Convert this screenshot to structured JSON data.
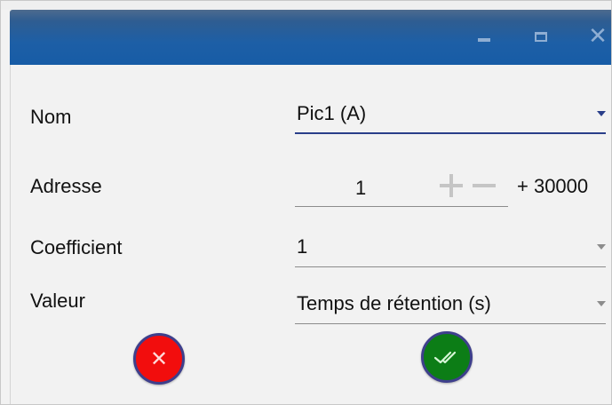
{
  "window": {
    "minimize_icon": "minimize-icon",
    "maximize_icon": "maximize-icon",
    "close_icon": "close-icon",
    "close_glyph": "✕"
  },
  "form": {
    "nom": {
      "label": "Nom",
      "value": "Pic1 (A)"
    },
    "adresse": {
      "label": "Adresse",
      "value": "1",
      "offset": "+ 30000"
    },
    "coefficient": {
      "label": "Coefficient",
      "value": "1"
    },
    "valeur": {
      "label": "Valeur",
      "value": "Temps de rétention (s)"
    }
  },
  "actions": {
    "cancel_glyph": "✕",
    "cancel_color": "#f20d0d",
    "ok_color": "#0c7d16",
    "ok_icon": "double-check-icon"
  },
  "colors": {
    "titlebar": "#175ca6",
    "active_underline": "#2a3f8a",
    "button_border": "#3e3f8c"
  }
}
